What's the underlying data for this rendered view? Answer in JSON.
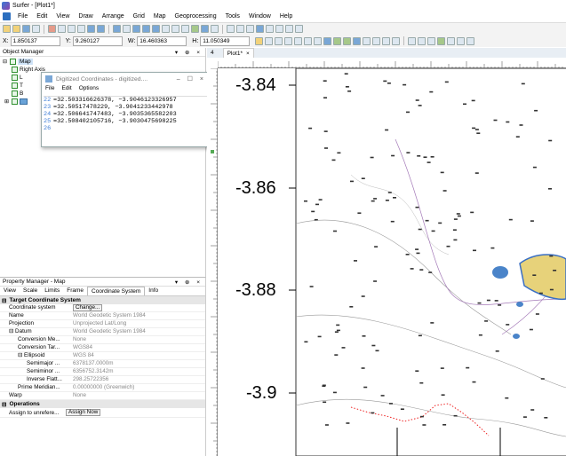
{
  "app": {
    "title": "Surfer - [Plot1*]"
  },
  "menus": [
    "File",
    "Edit",
    "View",
    "Draw",
    "Arrange",
    "Grid",
    "Map",
    "Geoprocessing",
    "Tools",
    "Window",
    "Help"
  ],
  "coords": {
    "x_label": "X:",
    "x_value": "1.850137",
    "y_label": "Y:",
    "y_value": "9.260127",
    "w_label": "W:",
    "w_value": "16.460363",
    "h_label": "H:",
    "h_value": "11.050349"
  },
  "object_manager": {
    "title": "Object Manager",
    "root_label": "Map",
    "child_labels": [
      "Right Axis",
      "L",
      "T",
      "B",
      ""
    ]
  },
  "dialog": {
    "title": "Digitized Coordinates - digitized....",
    "menu": [
      "File",
      "Edit",
      "Options"
    ],
    "lines": [
      {
        "n": "22",
        "text": "=32.503316626378, −3.9046123326957"
      },
      {
        "n": "23",
        "text": "=32.50517478229, −3.9041233442978"
      },
      {
        "n": "24",
        "text": "=32.506641747483, −3.9035365582203"
      },
      {
        "n": "25",
        "text": "=32.508402105716, −3.9030475698225"
      },
      {
        "n": "26",
        "text": ""
      }
    ]
  },
  "property_manager": {
    "title": "Property Manager - Map",
    "tabs": [
      "View",
      "Scale",
      "Limits",
      "Frame",
      "Coordinate System",
      "Info"
    ],
    "active_tab": "Coordinate System",
    "section_target": "Target Coordinate System",
    "rows": [
      {
        "key": "Coordinate system",
        "value": "Change..."
      },
      {
        "key": "Name",
        "value": "World Geodetic System 1984"
      },
      {
        "key": "Projection",
        "value": "Unprojected Lat/Long"
      },
      {
        "key": "Datum",
        "value": "World Geodetic System 1984"
      },
      {
        "key": "Conversion Me...",
        "value": "None"
      },
      {
        "key": "Conversion Tar...",
        "value": "WGS84"
      },
      {
        "key": "Ellipsoid",
        "value": "WGS 84"
      },
      {
        "key": "Semimajor ...",
        "value": "6378137.0000m"
      },
      {
        "key": "Semiminor ...",
        "value": "6356752.3142m"
      },
      {
        "key": "Inverse Flatt...",
        "value": "298.25722356"
      },
      {
        "key": "Prime Meridian...",
        "value": "0.00000000 (Greenwich)"
      },
      {
        "key": "Warp",
        "value": "None"
      }
    ],
    "section_ops": "Operations",
    "ops_left": "Assign to unrefere...",
    "ops_btn": "Assign Now"
  },
  "doc_tab": {
    "label": "Plot1*",
    "close": "×",
    "num": "4"
  },
  "plot": {
    "y_ticks": [
      "-3.84",
      "-3.86",
      "-3.88",
      "-3.9"
    ]
  }
}
